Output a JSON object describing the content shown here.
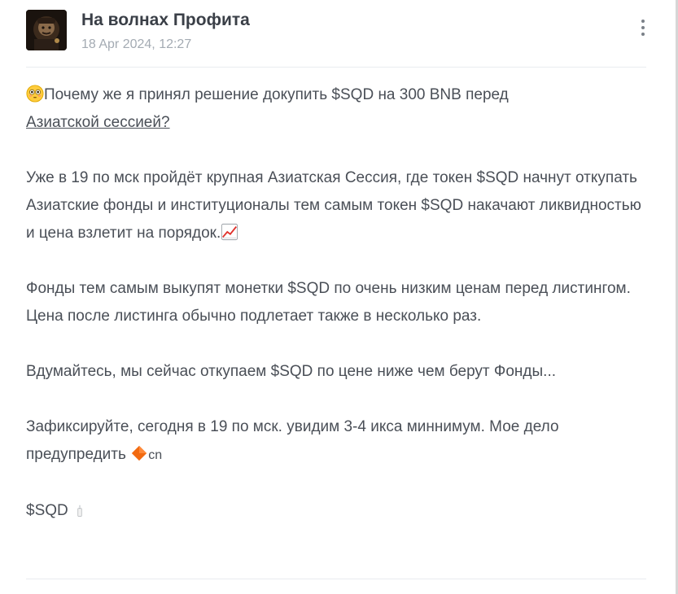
{
  "channel": {
    "name": "На волнах Профита",
    "date": "18 Apr 2024, 12:27"
  },
  "post": {
    "p1_text": "Почему же я принял решение докупить $SQD на 300 BNB перед",
    "p1_link": "Азиатской сессией?",
    "p2_text": "Уже в 19 по мск пройдёт крупная Азиатская Сессия, где токен $SQD начнут откупать Азиатские фонды и институционалы тем самым токен $SQD накачают ликвидностью и цена взлетит на порядок.",
    "p3_text": "Фонды тем самым выкупят монетки $SQD по очень низким ценам перед листингом. Цена после листинга обычно подлетает также в несколько раз.",
    "p4_text": "Вдумайтесь, мы сейчас откупаем $SQD по цене ниже чем берут Фонды...",
    "p5_text": "Зафиксируйте, сегодня в 19 по мск. увидим 3-4 икса миннимум. Мое дело предупредить",
    "p5_suffix": "cn",
    "p6_text": "$SQD"
  },
  "icons": {
    "p1_emoji": "flushed-face-icon",
    "p2_emoji": "chart-increasing-icon",
    "p5_emoji": "orange-diamond-icon",
    "p6_emoji": "candle-icon",
    "menu": "more-vertical-icon"
  },
  "colors": {
    "name": "#3a3f47",
    "date": "#a4abb3",
    "body": "#4a4f57",
    "divider": "#e9ecef",
    "diamond": "#f26a10"
  }
}
